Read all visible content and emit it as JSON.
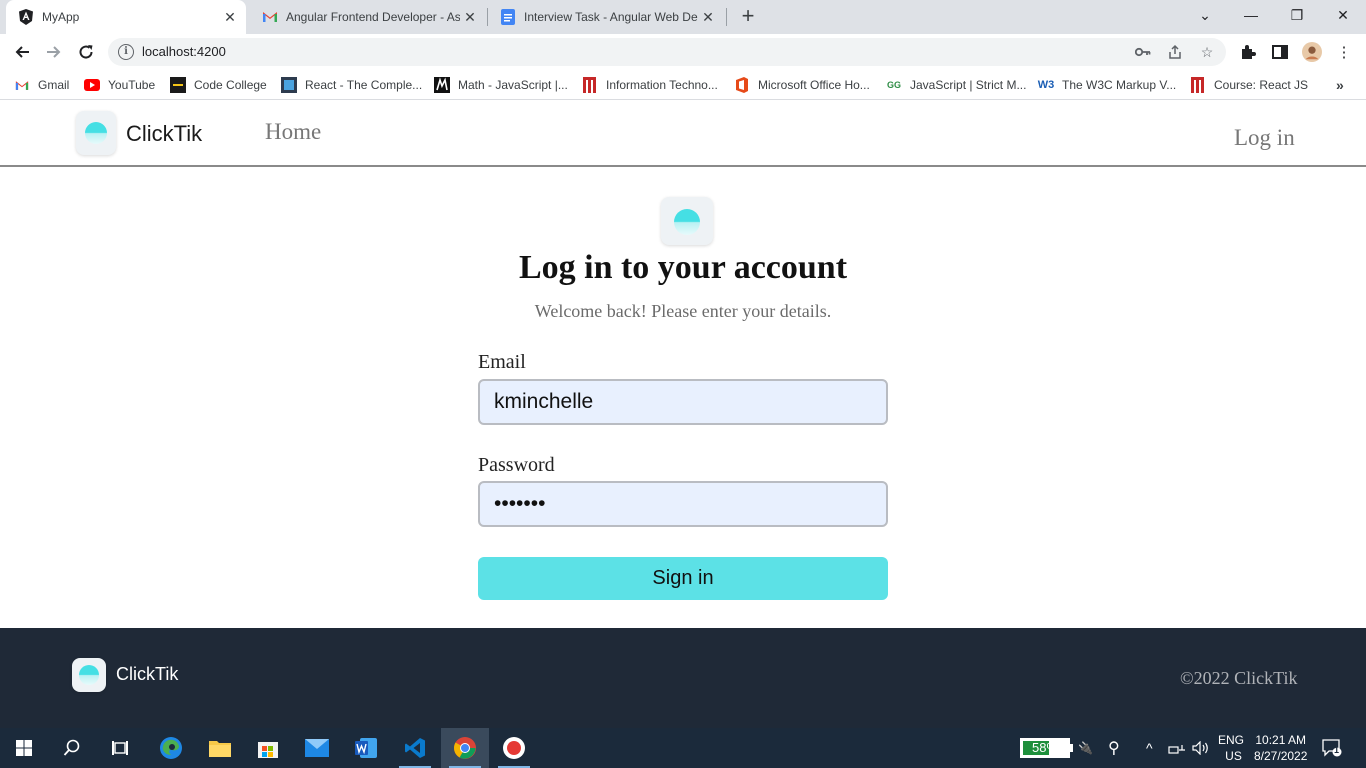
{
  "browser": {
    "tabs": [
      {
        "title": "MyApp",
        "favicon": "angular-icon"
      },
      {
        "title": "Angular Frontend Developer - As",
        "favicon": "gmail-icon"
      },
      {
        "title": "Interview Task - Angular Web De",
        "favicon": "docs-icon"
      }
    ],
    "url": "localhost:4200",
    "bookmarks": [
      {
        "label": "Gmail"
      },
      {
        "label": "YouTube"
      },
      {
        "label": "Code College"
      },
      {
        "label": "React - The Comple..."
      },
      {
        "label": "Math - JavaScript |..."
      },
      {
        "label": "Information Techno..."
      },
      {
        "label": "Microsoft Office Ho..."
      },
      {
        "label": "JavaScript | Strict M..."
      },
      {
        "label": "The W3C Markup V..."
      },
      {
        "label": "Course: React JS"
      }
    ]
  },
  "app": {
    "brand": "ClickTik",
    "nav": {
      "home": "Home",
      "login": "Log in"
    },
    "login": {
      "heading": "Log in to your account",
      "subheading": "Welcome back! Please enter your details.",
      "email_label": "Email",
      "email_value": "kminchelle",
      "password_label": "Password",
      "password_value": "0lelplR",
      "submit_label": "Sign in"
    },
    "footer": {
      "brand": "ClickTik",
      "copyright": "©2022 ClickTik"
    }
  },
  "taskbar": {
    "battery_percent": "58%",
    "battery_level": 0.58,
    "language": "ENG",
    "region": "US",
    "time": "10:21 AM",
    "date": "8/27/2022",
    "notification_count": "1"
  },
  "colors": {
    "accent": "#5ce1e6",
    "footer_bg": "#1f2937",
    "input_bg": "#e8f0fe"
  }
}
